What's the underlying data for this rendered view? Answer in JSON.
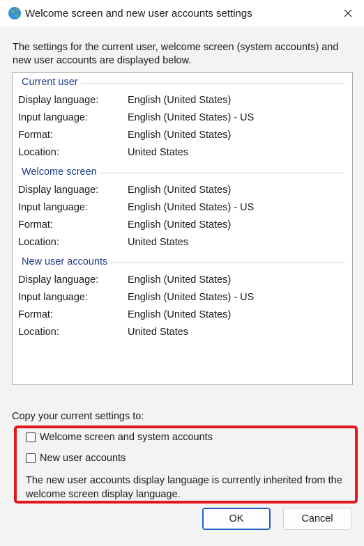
{
  "window": {
    "title": "Welcome screen and new user accounts settings"
  },
  "intro_text": "The settings for the current user, welcome screen (system accounts) and new user accounts are displayed below.",
  "groups": [
    {
      "title": "Current user",
      "rows": [
        {
          "key": "Display language:",
          "value": "English (United States)"
        },
        {
          "key": "Input language:",
          "value": "English (United States) - US"
        },
        {
          "key": "Format:",
          "value": "English (United States)"
        },
        {
          "key": "Location:",
          "value": "United States"
        }
      ]
    },
    {
      "title": "Welcome screen",
      "rows": [
        {
          "key": "Display language:",
          "value": "English (United States)"
        },
        {
          "key": "Input language:",
          "value": "English (United States) - US"
        },
        {
          "key": "Format:",
          "value": "English (United States)"
        },
        {
          "key": "Location:",
          "value": "United States"
        }
      ]
    },
    {
      "title": "New user accounts",
      "rows": [
        {
          "key": "Display language:",
          "value": "English (United States)"
        },
        {
          "key": "Input language:",
          "value": "English (United States) - US"
        },
        {
          "key": "Format:",
          "value": "English (United States)"
        },
        {
          "key": "Location:",
          "value": "United States"
        }
      ]
    }
  ],
  "copy": {
    "label": "Copy your current settings to:",
    "welcome_checkbox_label": "Welcome screen and system accounts",
    "welcome_checked": false,
    "new_users_checkbox_label": "New user accounts",
    "new_users_checked": false,
    "note": "The new user accounts display language is currently inherited from the welcome screen display language."
  },
  "buttons": {
    "ok": "OK",
    "cancel": "Cancel"
  },
  "colors": {
    "group_title": "#1f3f87",
    "highlight": "#e3161b",
    "ok_border": "#1f5fbf"
  },
  "icons": {
    "app": "globe-icon",
    "close": "close-icon"
  }
}
